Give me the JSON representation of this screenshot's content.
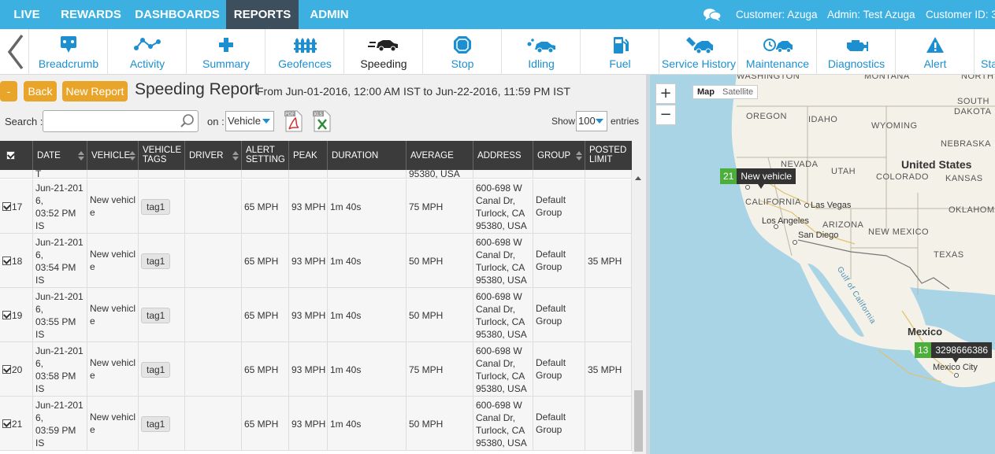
{
  "topnav": {
    "tabs": [
      {
        "label": "LIVE"
      },
      {
        "label": "REWARDS"
      },
      {
        "label": "DASHBOARDS"
      },
      {
        "label": "REPORTS"
      },
      {
        "label": "ADMIN"
      }
    ],
    "active_tab": "REPORTS",
    "customer": "Customer: Azuga",
    "admin": "Admin: Test Azuga",
    "customer_id": "Customer ID: 3"
  },
  "toolbar": {
    "items": [
      {
        "label": "Breadcrumb",
        "icon": "breadcrumb-icon"
      },
      {
        "label": "Activity",
        "icon": "activity-icon"
      },
      {
        "label": "Summary",
        "icon": "plus-icon"
      },
      {
        "label": "Geofences",
        "icon": "fence-icon"
      },
      {
        "label": "Speeding",
        "icon": "speeding-car-icon"
      },
      {
        "label": "Stop",
        "icon": "stop-icon"
      },
      {
        "label": "Idling",
        "icon": "idling-icon"
      },
      {
        "label": "Fuel",
        "icon": "fuel-icon"
      },
      {
        "label": "Service History",
        "icon": "service-history-icon"
      },
      {
        "label": "Maintenance",
        "icon": "maintenance-icon"
      },
      {
        "label": "Diagnostics",
        "icon": "engine-icon"
      },
      {
        "label": "Alert",
        "icon": "alert-icon"
      },
      {
        "label": "Sta",
        "icon": ""
      }
    ],
    "active_item": "Speeding"
  },
  "report": {
    "collapse_label": "-",
    "back_label": "Back",
    "new_report_label": "New Report",
    "title": "Speeding Report",
    "range": "From Jun-01-2016, 12:00 AM IST to Jun-22-2016, 11:59 PM IST",
    "search_label": "Search :",
    "search_value": "",
    "on_label": "on :",
    "on_value": "Vehicle",
    "show_label": "Show",
    "show_value": "100",
    "entries_label": "entries",
    "pdf_label": "PDF",
    "xls_label": "XLS"
  },
  "table": {
    "columns": [
      "DATE",
      "VEHICLE",
      "VEHICLE TAGS",
      "DRIVER",
      "ALERT SETTING",
      "PEAK",
      "DURATION",
      "AVERAGE",
      "ADDRESS",
      "GROUP",
      "POSTED LIMIT"
    ],
    "partial_row": {
      "date": "T",
      "address": "95380, USA"
    },
    "rows": [
      {
        "num": "17",
        "date_lines": [
          "Jun-21-201",
          "6,",
          "03:52 PM IS",
          "T"
        ],
        "vehicle_lines": [
          "New vehicl",
          "e"
        ],
        "tag": "tag1",
        "driver": "",
        "alert": "65 MPH",
        "peak": "93 MPH",
        "duration": "1m 40s",
        "average": "75 MPH",
        "address_lines": [
          "600-698 W",
          "Canal Dr,",
          "Turlock, CA",
          "95380, USA"
        ],
        "group_lines": [
          "Default",
          "Group"
        ],
        "limit": ""
      },
      {
        "num": "18",
        "date_lines": [
          "Jun-21-201",
          "6,",
          "03:54 PM IS",
          "T"
        ],
        "vehicle_lines": [
          "New vehicl",
          "e"
        ],
        "tag": "tag1",
        "driver": "",
        "alert": "65 MPH",
        "peak": "93 MPH",
        "duration": "1m 40s",
        "average": "50 MPH",
        "address_lines": [
          "600-698 W",
          "Canal Dr,",
          "Turlock, CA",
          "95380, USA"
        ],
        "group_lines": [
          "Default",
          "Group"
        ],
        "limit": "35 MPH"
      },
      {
        "num": "19",
        "date_lines": [
          "Jun-21-201",
          "6,",
          "03:55 PM IS",
          "T"
        ],
        "vehicle_lines": [
          "New vehicl",
          "e"
        ],
        "tag": "tag1",
        "driver": "",
        "alert": "65 MPH",
        "peak": "93 MPH",
        "duration": "1m 40s",
        "average": "50 MPH",
        "address_lines": [
          "600-698 W",
          "Canal Dr,",
          "Turlock, CA",
          "95380, USA"
        ],
        "group_lines": [
          "Default",
          "Group"
        ],
        "limit": ""
      },
      {
        "num": "20",
        "date_lines": [
          "Jun-21-201",
          "6,",
          "03:58 PM IS",
          "T"
        ],
        "vehicle_lines": [
          "New vehicl",
          "e"
        ],
        "tag": "tag1",
        "driver": "",
        "alert": "65 MPH",
        "peak": "93 MPH",
        "duration": "1m 40s",
        "average": "75 MPH",
        "address_lines": [
          "600-698 W",
          "Canal Dr,",
          "Turlock, CA",
          "95380, USA"
        ],
        "group_lines": [
          "Default",
          "Group"
        ],
        "limit": "35 MPH"
      },
      {
        "num": "21",
        "date_lines": [
          "Jun-21-201",
          "6,",
          "03:59 PM IS",
          "T"
        ],
        "vehicle_lines": [
          "New vehicl",
          "e"
        ],
        "tag": "tag1",
        "driver": "",
        "alert": "65 MPH",
        "peak": "93 MPH",
        "duration": "1m 40s",
        "average": "50 MPH",
        "address_lines": [
          "600-698 W",
          "Canal Dr,",
          "Turlock, CA",
          "95380, USA"
        ],
        "group_lines": [
          "Default",
          "Group"
        ],
        "limit": ""
      }
    ]
  },
  "map": {
    "zoom_in": "+",
    "zoom_out": "−",
    "type_map": "Map",
    "type_satellite": "Satellite",
    "labels": {
      "washington": "WASHINGTON",
      "montana": "MONTANA",
      "north_dakota": "NORTH",
      "oregon": "OREGON",
      "idaho": "IDAHO",
      "south_dakota_1": "SOUTH",
      "south_dakota_2": "DAKOTA",
      "wyoming": "WYOMING",
      "nebraska": "NEBRASKA",
      "nevada": "NEVADA",
      "utah": "UTAH",
      "united_states": "United States",
      "colorado": "COLORADO",
      "kansas": "KANSAS",
      "california": "CALIFORNIA",
      "las_vegas": "Las Vegas",
      "oklahoma": "OKLAHOMA",
      "los_angeles": "Los Angeles",
      "arizona": "ARIZONA",
      "san_diego": "San Diego",
      "new_mexico": "NEW MEXICO",
      "texas": "TEXAS",
      "gulf": "Gulf of California",
      "mexico": "Mexico",
      "mexico_city": "Mexico City"
    },
    "markers": [
      {
        "count": "21",
        "name": "New vehicle"
      },
      {
        "count": "13",
        "name": "3298666386"
      }
    ]
  }
}
